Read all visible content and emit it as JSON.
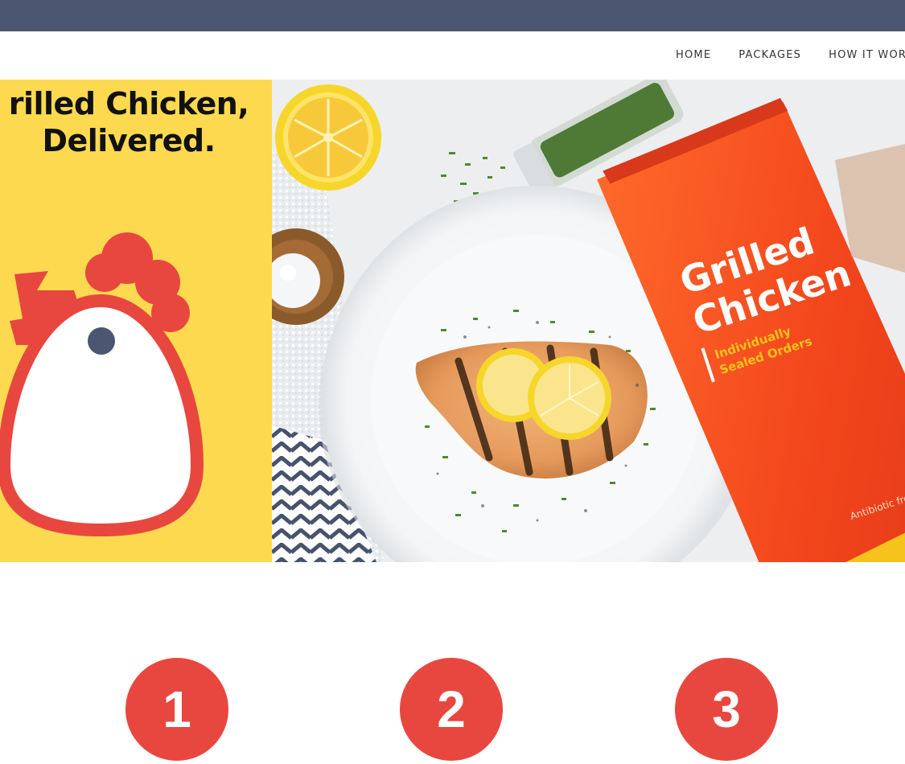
{
  "nav": {
    "items": [
      "HOME",
      "PACKAGES",
      "HOW IT WOR"
    ]
  },
  "hero": {
    "headline_line1": "rilled Chicken,",
    "headline_line2": "Delivered.",
    "bag": {
      "title_line1": "Grilled",
      "title_line2": "Chicken",
      "subtitle_line1": "Individually",
      "subtitle_line2": "Sealed Orders",
      "footer": "Antibiotic free"
    }
  },
  "steps": [
    "1",
    "2",
    "3"
  ],
  "colors": {
    "topbar": "#4b5670",
    "accent_red": "#e8473f",
    "hero_yellow": "#fdd94f",
    "bag_orange": "#f2521f"
  }
}
